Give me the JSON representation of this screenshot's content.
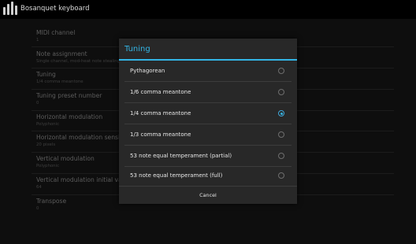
{
  "app": {
    "title": "Bosanquet keyboard",
    "icon": "app-keys-icon"
  },
  "settings": {
    "items": [
      {
        "title": "MIDI channel",
        "summary": "1"
      },
      {
        "title": "Note assignment",
        "summary": "Single channel, mod-heat note stealing"
      },
      {
        "title": "Tuning",
        "summary": "1/4 comma meantone"
      },
      {
        "title": "Tuning preset number",
        "summary": "0"
      },
      {
        "title": "Horizontal modulation",
        "summary": "Polyphonic"
      },
      {
        "title": "Horizontal modulation sensitivity",
        "summary": "20 pixels"
      },
      {
        "title": "Vertical modulation",
        "summary": "Polyphonic"
      },
      {
        "title": "Vertical modulation initial value",
        "summary": "64"
      },
      {
        "title": "Transpose",
        "summary": "0"
      }
    ]
  },
  "dialog": {
    "title": "Tuning",
    "accent_color": "#33b5e5",
    "options": [
      {
        "label": "Pythagorean",
        "checked": false
      },
      {
        "label": "1/6 comma meantone",
        "checked": false
      },
      {
        "label": "1/4 comma meantone",
        "checked": true
      },
      {
        "label": "1/3 comma meantone",
        "checked": false
      },
      {
        "label": "53 note equal temperament (partial)",
        "checked": false
      },
      {
        "label": "53 note equal temperament (full)",
        "checked": false
      }
    ],
    "cancel_label": "Cancel"
  }
}
